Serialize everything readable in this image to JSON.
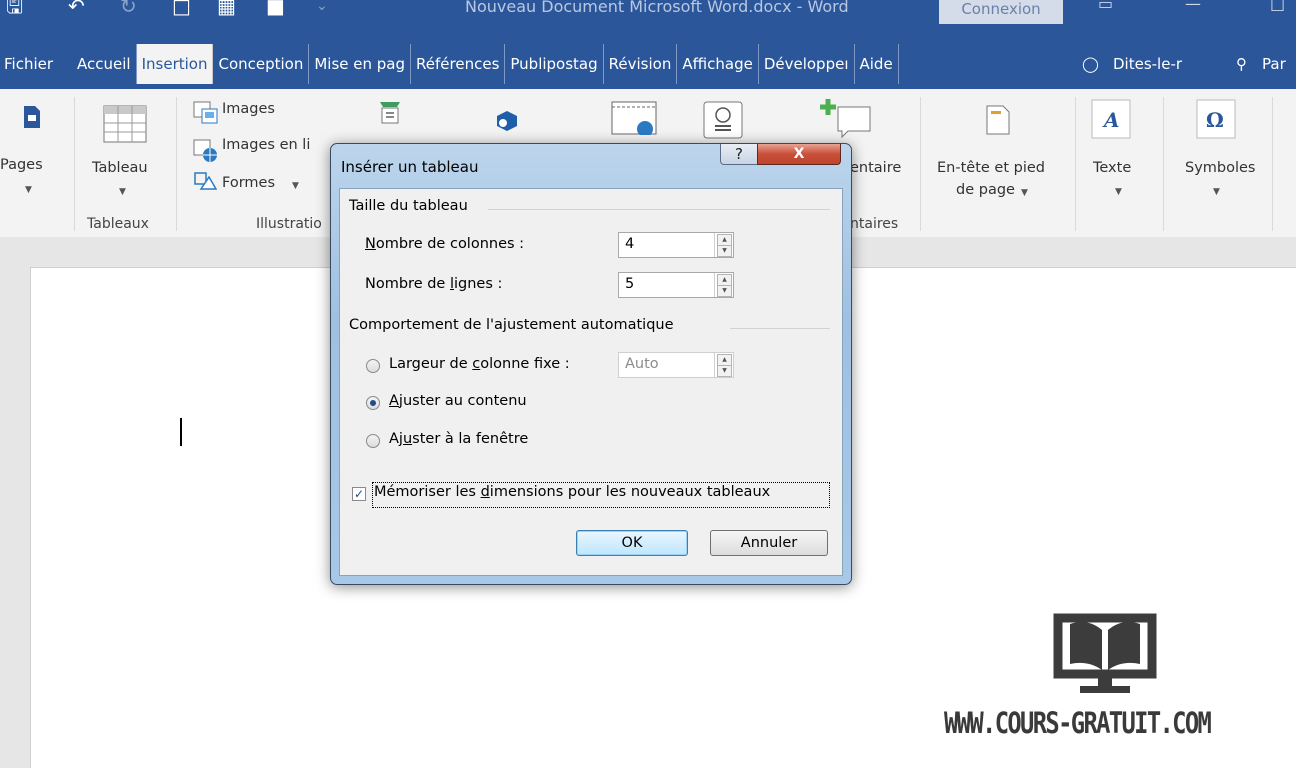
{
  "titlebar": {
    "document_title": "Nouveau Document Microsoft Word.docx  -  Word",
    "connexion": "Connexion"
  },
  "tabs": [
    {
      "label": "Fichier"
    },
    {
      "label": "Accueil"
    },
    {
      "label": "Insertion"
    },
    {
      "label": "Conception"
    },
    {
      "label": "Mise en pag"
    },
    {
      "label": "Références"
    },
    {
      "label": "Publipostag"
    },
    {
      "label": "Révision"
    },
    {
      "label": "Affichage"
    },
    {
      "label": "Développeı"
    },
    {
      "label": "Aide"
    }
  ],
  "tellme": {
    "label": "Dites-le-r"
  },
  "share": {
    "label": "Par"
  },
  "ribbon": {
    "pages": "Pages",
    "tableau": "Tableau",
    "tableaux_group": "Tableaux",
    "images": "Images",
    "images_en_ligne": "Images en li",
    "formes": "Formes",
    "illustrations_group": "Illustratio",
    "commentaire": "entaire",
    "commentaires_group": "ntaires",
    "entete_line1": "En-tête et pied",
    "entete_line2": "de page",
    "texte": "Texte",
    "symboles": "Symboles"
  },
  "dialog": {
    "title": "Insérer un tableau",
    "help": "?",
    "close": "X",
    "taille_section": "Taille du tableau",
    "colonnes_label_u": "N",
    "colonnes_label_rest": "ombre de colonnes :",
    "colonnes_value": "4",
    "lignes_label_pre": "Nombre de ",
    "lignes_label_u": "l",
    "lignes_label_rest": "ignes :",
    "lignes_value": "5",
    "ajustement_section": "Comportement de l'ajustement automatique",
    "opt_fixe_pre": "Largeur de ",
    "opt_fixe_u": "c",
    "opt_fixe_rest": "olonne fixe :",
    "fixe_value": "Auto",
    "opt_contenu_u": "A",
    "opt_contenu_rest": "juster au contenu",
    "opt_fenetre_pre": "Aj",
    "opt_fenetre_u": "u",
    "opt_fenetre_rest": "ster à la fenêtre",
    "memoriser_pre": "Mémoriser les ",
    "memoriser_u": "d",
    "memoriser_rest": "imensions pour les nouveaux tableaux",
    "ok": "OK",
    "annuler": "Annuler",
    "selected_option": "Ajuster au contenu",
    "memoriser_checked": true
  },
  "watermark": {
    "text": "WWW.COURS-GRATUIT.COM"
  },
  "colors": {
    "word_blue": "#2b579a",
    "ribbon_bg": "#f3f3f3",
    "dialog_frame": "#a7c8e6",
    "close_red": "#c8503a"
  }
}
